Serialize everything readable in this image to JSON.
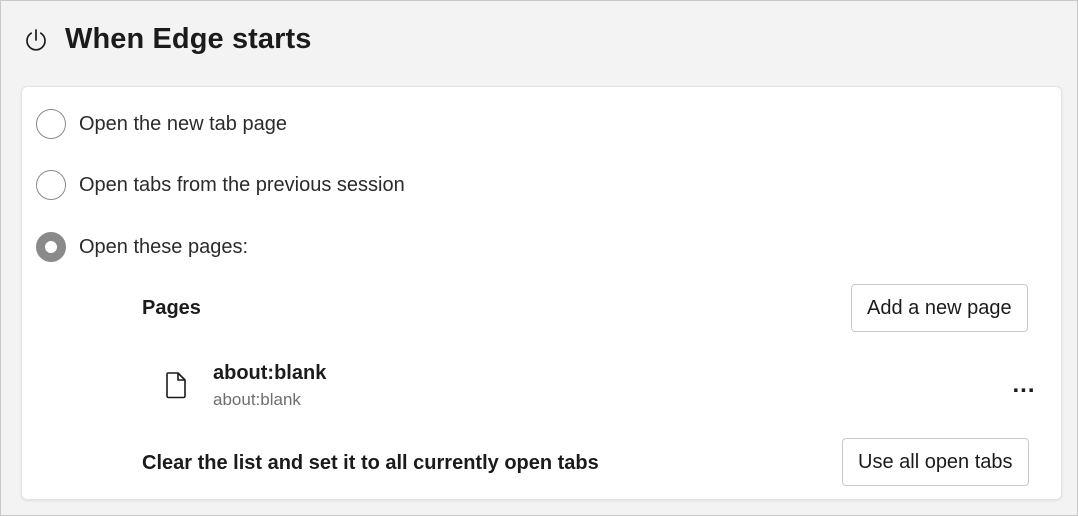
{
  "section": {
    "title": "When Edge starts",
    "icon": "power-icon"
  },
  "startup": {
    "options": [
      {
        "label": "Open the new tab page",
        "checked": false
      },
      {
        "label": "Open tabs from the previous session",
        "checked": false
      },
      {
        "label": "Open these pages:",
        "checked": true
      }
    ]
  },
  "pages": {
    "label": "Pages",
    "add_button": "Add a new page",
    "items": [
      {
        "title": "about:blank",
        "url": "about:blank",
        "icon": "file-icon",
        "more": "..."
      }
    ]
  },
  "clear": {
    "text": "Clear the list and set it to all currently open tabs",
    "button": "Use all open tabs"
  },
  "colors": {
    "radio": "#8a8a8a",
    "card_bg": "#ffffff",
    "page_bg": "#f3f3f3"
  }
}
